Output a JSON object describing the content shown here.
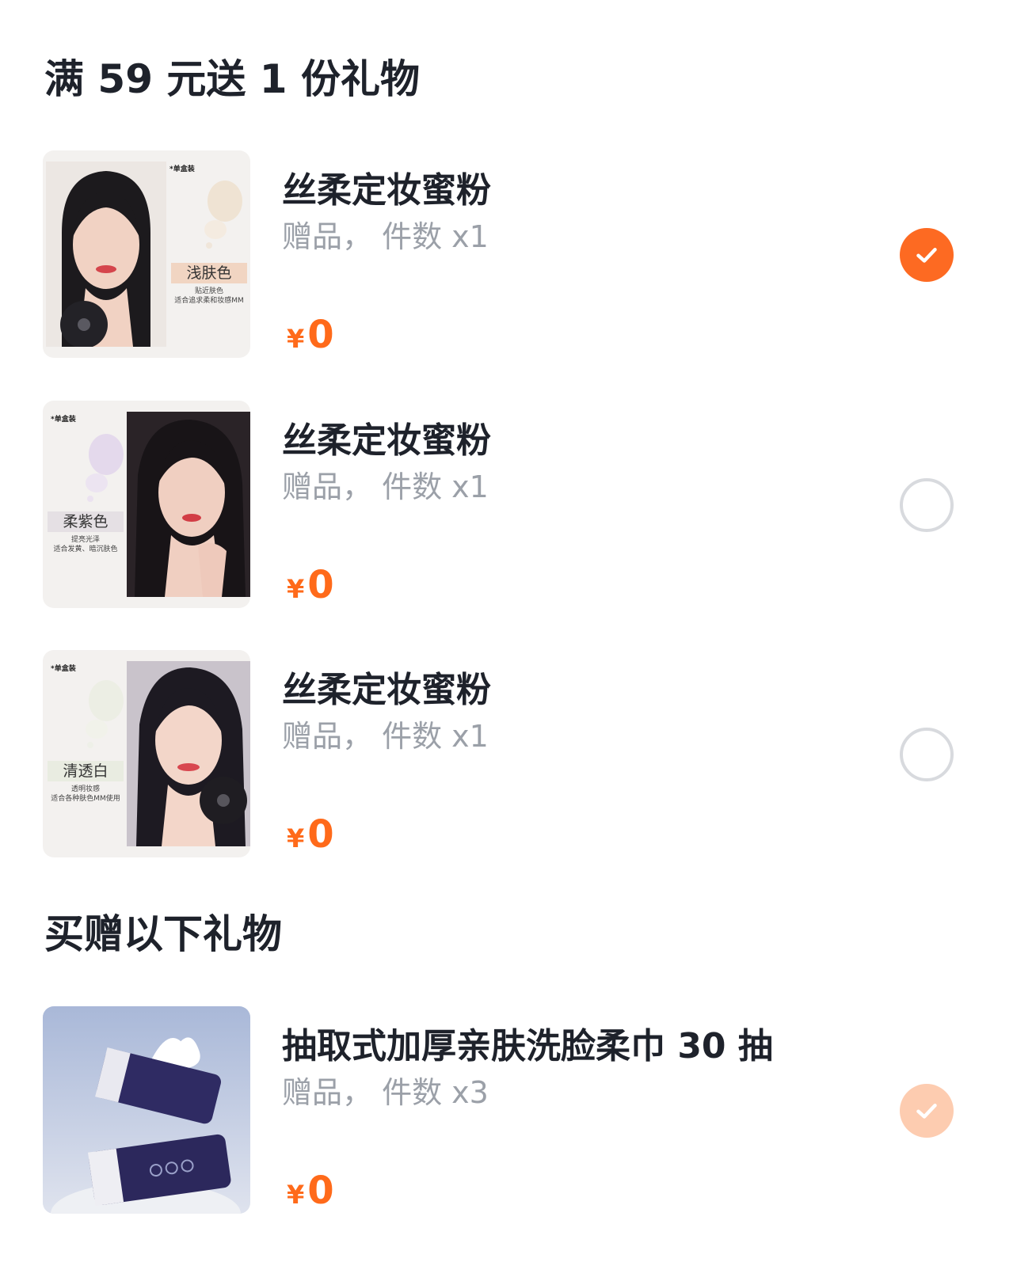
{
  "section1": {
    "title": "满 59 元送 1 份礼物"
  },
  "section2": {
    "title": "买赠以下礼物"
  },
  "items": [
    {
      "name": "丝柔定妆蜜粉",
      "sub": "赠品， 件数 x1",
      "currency": "¥",
      "price": "0",
      "selected": true,
      "thumb": {
        "tag": "*单盒装",
        "shade": "浅肤色",
        "desc1": "贴近肤色",
        "desc2": "适合追求柔和妆感MM"
      }
    },
    {
      "name": "丝柔定妆蜜粉",
      "sub": "赠品， 件数 x1",
      "currency": "¥",
      "price": "0",
      "selected": false,
      "thumb": {
        "tag": "*单盒装",
        "shade": "柔紫色",
        "desc1": "提亮光泽",
        "desc2": "适合发黄、暗沉肤色"
      }
    },
    {
      "name": "丝柔定妆蜜粉",
      "sub": "赠品， 件数 x1",
      "currency": "¥",
      "price": "0",
      "selected": false,
      "thumb": {
        "tag": "*单盒装",
        "shade": "清透白",
        "desc1": "透明妆感",
        "desc2": "适合各种肤色MM使用"
      }
    },
    {
      "name": "抽取式加厚亲肤洗脸柔巾 30 抽",
      "sub": "赠品， 件数 x3",
      "currency": "¥",
      "price": "0",
      "selected": true
    }
  ],
  "colors": {
    "accent": "#fd6a22",
    "accent_light": "#fdccb0",
    "price": "#ff6a1a"
  }
}
